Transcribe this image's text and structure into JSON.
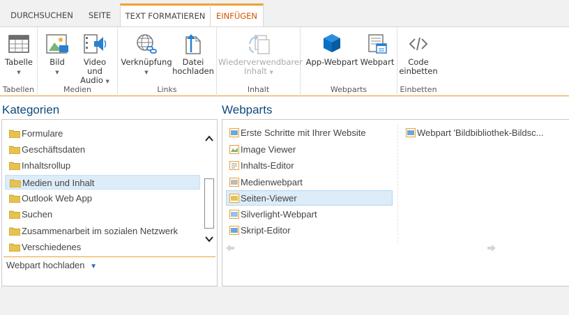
{
  "tabs": [
    {
      "label": "DURCHSUCHEN"
    },
    {
      "label": "SEITE"
    },
    {
      "label": "TEXT FORMATIEREN"
    },
    {
      "label": "EINFÜGEN"
    }
  ],
  "ribbon": {
    "groups": {
      "tabellen": "Tabellen",
      "medien": "Medien",
      "links": "Links",
      "inhalt": "Inhalt",
      "webparts": "Webparts",
      "einbetten": "Einbetten"
    },
    "buttons": {
      "tabelle": "Tabelle",
      "bild": "Bild",
      "video_l1": "Video und",
      "video_l2": "Audio",
      "verknuepfung": "Verknüpfung",
      "datei_l1": "Datei",
      "datei_l2": "hochladen",
      "wieder_l1": "Wiederverwendbarer",
      "wieder_l2": "Inhalt",
      "appwebpart": "App-Webpart",
      "webpart": "Webpart",
      "code_l1": "Code",
      "code_l2": "einbetten"
    }
  },
  "kategorien": {
    "heading": "Kategorien",
    "items": [
      {
        "label": "Formulare"
      },
      {
        "label": "Geschäftsdaten"
      },
      {
        "label": "Inhaltsrollup"
      },
      {
        "label": "Medien und Inhalt"
      },
      {
        "label": "Outlook Web App"
      },
      {
        "label": "Suchen"
      },
      {
        "label": "Zusammenarbeit im sozialen Netzwerk"
      },
      {
        "label": "Verschiedenes"
      }
    ],
    "upload": "Webpart hochladen"
  },
  "webparts": {
    "heading": "Webparts",
    "items": [
      {
        "label": "Erste Schritte mit Ihrer Website"
      },
      {
        "label": "Image Viewer"
      },
      {
        "label": "Inhalts-Editor"
      },
      {
        "label": "Medienwebpart"
      },
      {
        "label": "Seiten-Viewer"
      },
      {
        "label": "Silverlight-Webpart"
      },
      {
        "label": "Skript-Editor"
      }
    ],
    "right_item": "Webpart 'Bildbibliothek-Bildsc..."
  },
  "colors": {
    "accent": "#f0a030",
    "active_tab": "#d35400",
    "heading": "#0e4a7a",
    "selection": "#dcecf8"
  }
}
